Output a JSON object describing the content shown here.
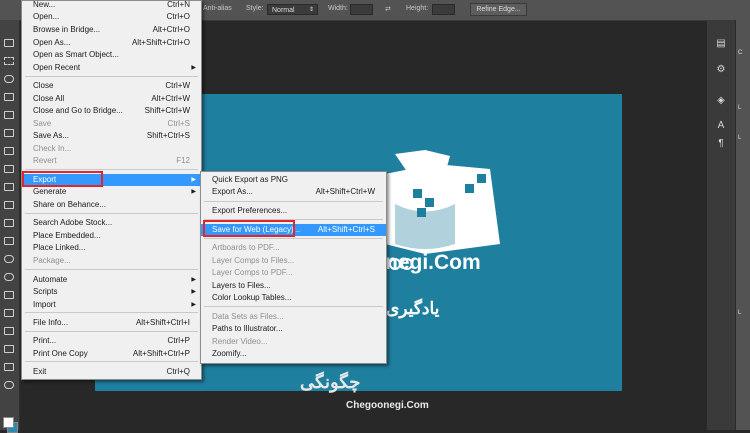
{
  "options_bar": {
    "antialias_label": "Anti-alias",
    "style_label": "Style:",
    "style_value": "Normal",
    "width_label": "Width:",
    "height_label": "Height:",
    "refine_edge_label": "Refine Edge..."
  },
  "file_menu": {
    "items": [
      {
        "label": "New...",
        "shortcut": "Ctrl+N"
      },
      {
        "label": "Open...",
        "shortcut": "Ctrl+O"
      },
      {
        "label": "Browse in Bridge...",
        "shortcut": "Alt+Ctrl+O"
      },
      {
        "label": "Open As...",
        "shortcut": "Alt+Shift+Ctrl+O"
      },
      {
        "label": "Open as Smart Object...",
        "shortcut": ""
      },
      {
        "label": "Open Recent",
        "shortcut": "▶"
      },
      {
        "label": "Close",
        "shortcut": "Ctrl+W"
      },
      {
        "label": "Close All",
        "shortcut": "Alt+Ctrl+W"
      },
      {
        "label": "Close and Go to Bridge...",
        "shortcut": "Shift+Ctrl+W"
      },
      {
        "label": "Save",
        "shortcut": "Ctrl+S"
      },
      {
        "label": "Save As...",
        "shortcut": "Shift+Ctrl+S"
      },
      {
        "label": "Check In...",
        "shortcut": ""
      },
      {
        "label": "Revert",
        "shortcut": "F12"
      },
      {
        "label": "Export",
        "shortcut": "▶"
      },
      {
        "label": "Generate",
        "shortcut": "▶"
      },
      {
        "label": "Share on Behance...",
        "shortcut": ""
      },
      {
        "label": "Search Adobe Stock...",
        "shortcut": ""
      },
      {
        "label": "Place Embedded...",
        "shortcut": ""
      },
      {
        "label": "Place Linked...",
        "shortcut": ""
      },
      {
        "label": "Package...",
        "shortcut": ""
      },
      {
        "label": "Automate",
        "shortcut": "▶"
      },
      {
        "label": "Scripts",
        "shortcut": "▶"
      },
      {
        "label": "Import",
        "shortcut": "▶"
      },
      {
        "label": "File Info...",
        "shortcut": "Alt+Shift+Ctrl+I"
      },
      {
        "label": "Print...",
        "shortcut": "Ctrl+P"
      },
      {
        "label": "Print One Copy",
        "shortcut": "Alt+Shift+Ctrl+P"
      },
      {
        "label": "Exit",
        "shortcut": "Ctrl+Q"
      }
    ]
  },
  "export_menu": {
    "items": [
      {
        "label": "Quick Export as PNG",
        "shortcut": ""
      },
      {
        "label": "Export As...",
        "shortcut": "Alt+Shift+Ctrl+W"
      },
      {
        "label": "Export Preferences...",
        "shortcut": ""
      },
      {
        "label": "Save for Web (Legacy)...",
        "shortcut": "Alt+Shift+Ctrl+S"
      },
      {
        "label": "Artboards to PDF...",
        "shortcut": ""
      },
      {
        "label": "Layer Comps to Files...",
        "shortcut": ""
      },
      {
        "label": "Layer Comps to PDF...",
        "shortcut": ""
      },
      {
        "label": "Layers to Files...",
        "shortcut": ""
      },
      {
        "label": "Color Lookup Tables...",
        "shortcut": ""
      },
      {
        "label": "Data Sets as Files...",
        "shortcut": ""
      },
      {
        "label": "Paths to Illustrator...",
        "shortcut": ""
      },
      {
        "label": "Render Video...",
        "shortcut": ""
      },
      {
        "label": "Zoomify...",
        "shortcut": ""
      }
    ]
  },
  "canvas": {
    "brand_text": "negi.Com",
    "persian_text": "یادگیری"
  },
  "watermark": {
    "persian": "چگونگی",
    "latin": "Chegoonegi.Com"
  },
  "colors": {
    "highlight": "#3399ff",
    "canvas_teal": "#1f7f9e",
    "annotation_red": "#e0262b"
  }
}
